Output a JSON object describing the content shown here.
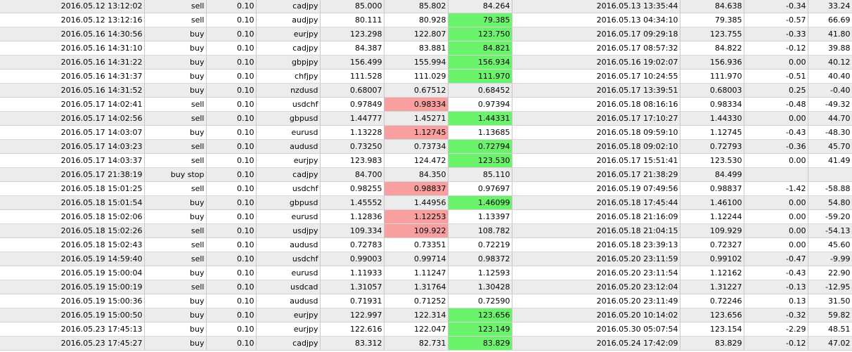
{
  "colors": {
    "profit_highlight": "#6cf36c",
    "loss_highlight": "#f8a0a0",
    "row_alt": "#ececec"
  },
  "rows": [
    {
      "open_time": "2016.05.12 13:12:02",
      "type": "sell",
      "size": "0.10",
      "symbol": "cadjpy",
      "price": "85.000",
      "sl": "85.802",
      "tp": "84.264",
      "close_time": "2016.05.13 13:35:44",
      "close_price": "84.638",
      "swap": "-0.34",
      "profit": "33.24",
      "sl_hl": "",
      "tp_hl": ""
    },
    {
      "open_time": "2016.05.12 13:12:16",
      "type": "sell",
      "size": "0.10",
      "symbol": "audjpy",
      "price": "80.111",
      "sl": "80.928",
      "tp": "79.385",
      "close_time": "2016.05.13 04:34:10",
      "close_price": "79.385",
      "swap": "-0.57",
      "profit": "66.69",
      "sl_hl": "",
      "tp_hl": "green"
    },
    {
      "open_time": "2016.05.16 14:30:56",
      "type": "buy",
      "size": "0.10",
      "symbol": "eurjpy",
      "price": "123.298",
      "sl": "122.807",
      "tp": "123.750",
      "close_time": "2016.05.17 09:29:18",
      "close_price": "123.755",
      "swap": "-0.33",
      "profit": "41.80",
      "sl_hl": "",
      "tp_hl": "green"
    },
    {
      "open_time": "2016.05.16 14:31:10",
      "type": "buy",
      "size": "0.10",
      "symbol": "cadjpy",
      "price": "84.387",
      "sl": "83.881",
      "tp": "84.821",
      "close_time": "2016.05.17 08:57:32",
      "close_price": "84.822",
      "swap": "-0.12",
      "profit": "39.88",
      "sl_hl": "",
      "tp_hl": "green"
    },
    {
      "open_time": "2016.05.16 14:31:22",
      "type": "buy",
      "size": "0.10",
      "symbol": "gbpjpy",
      "price": "156.499",
      "sl": "155.994",
      "tp": "156.934",
      "close_time": "2016.05.16 19:02:07",
      "close_price": "156.936",
      "swap": "0.00",
      "profit": "40.12",
      "sl_hl": "",
      "tp_hl": "green"
    },
    {
      "open_time": "2016.05.16 14:31:37",
      "type": "buy",
      "size": "0.10",
      "symbol": "chfjpy",
      "price": "111.528",
      "sl": "111.029",
      "tp": "111.970",
      "close_time": "2016.05.17 10:24:55",
      "close_price": "111.970",
      "swap": "-0.51",
      "profit": "40.40",
      "sl_hl": "",
      "tp_hl": "green"
    },
    {
      "open_time": "2016.05.16 14:31:52",
      "type": "buy",
      "size": "0.10",
      "symbol": "nzdusd",
      "price": "0.68007",
      "sl": "0.67512",
      "tp": "0.68452",
      "close_time": "2016.05.17 13:39:51",
      "close_price": "0.68003",
      "swap": "0.25",
      "profit": "-0.40",
      "sl_hl": "",
      "tp_hl": ""
    },
    {
      "open_time": "2016.05.17 14:02:41",
      "type": "sell",
      "size": "0.10",
      "symbol": "usdchf",
      "price": "0.97849",
      "sl": "0.98334",
      "tp": "0.97394",
      "close_time": "2016.05.18 08:16:16",
      "close_price": "0.98334",
      "swap": "-0.48",
      "profit": "-49.32",
      "sl_hl": "red",
      "tp_hl": ""
    },
    {
      "open_time": "2016.05.17 14:02:56",
      "type": "sell",
      "size": "0.10",
      "symbol": "gbpusd",
      "price": "1.44777",
      "sl": "1.45271",
      "tp": "1.44331",
      "close_time": "2016.05.17 17:10:27",
      "close_price": "1.44330",
      "swap": "0.00",
      "profit": "44.70",
      "sl_hl": "",
      "tp_hl": "green"
    },
    {
      "open_time": "2016.05.17 14:03:07",
      "type": "buy",
      "size": "0.10",
      "symbol": "eurusd",
      "price": "1.13228",
      "sl": "1.12745",
      "tp": "1.13685",
      "close_time": "2016.05.18 09:59:10",
      "close_price": "1.12745",
      "swap": "-0.43",
      "profit": "-48.30",
      "sl_hl": "red",
      "tp_hl": ""
    },
    {
      "open_time": "2016.05.17 14:03:23",
      "type": "sell",
      "size": "0.10",
      "symbol": "audusd",
      "price": "0.73250",
      "sl": "0.73734",
      "tp": "0.72794",
      "close_time": "2016.05.18 09:02:10",
      "close_price": "0.72793",
      "swap": "-0.36",
      "profit": "45.70",
      "sl_hl": "",
      "tp_hl": "green"
    },
    {
      "open_time": "2016.05.17 14:03:37",
      "type": "sell",
      "size": "0.10",
      "symbol": "eurjpy",
      "price": "123.983",
      "sl": "124.472",
      "tp": "123.530",
      "close_time": "2016.05.17 15:51:41",
      "close_price": "123.530",
      "swap": "0.00",
      "profit": "41.49",
      "sl_hl": "",
      "tp_hl": "green"
    },
    {
      "open_time": "2016.05.17 21:38:19",
      "type": "buy stop",
      "size": "0.10",
      "symbol": "cadjpy",
      "price": "84.700",
      "sl": "84.350",
      "tp": "85.110",
      "close_time": "2016.05.17 21:38:29",
      "close_price": "84.499",
      "swap": "",
      "profit": "",
      "sl_hl": "",
      "tp_hl": ""
    },
    {
      "open_time": "2016.05.18 15:01:25",
      "type": "sell",
      "size": "0.10",
      "symbol": "usdchf",
      "price": "0.98255",
      "sl": "0.98837",
      "tp": "0.97697",
      "close_time": "2016.05.19 07:49:56",
      "close_price": "0.98837",
      "swap": "-1.42",
      "profit": "-58.88",
      "sl_hl": "red",
      "tp_hl": ""
    },
    {
      "open_time": "2016.05.18 15:01:54",
      "type": "buy",
      "size": "0.10",
      "symbol": "gbpusd",
      "price": "1.45552",
      "sl": "1.44956",
      "tp": "1.46099",
      "close_time": "2016.05.18 17:45:44",
      "close_price": "1.46100",
      "swap": "0.00",
      "profit": "54.80",
      "sl_hl": "",
      "tp_hl": "green"
    },
    {
      "open_time": "2016.05.18 15:02:06",
      "type": "buy",
      "size": "0.10",
      "symbol": "eurusd",
      "price": "1.12836",
      "sl": "1.12253",
      "tp": "1.13397",
      "close_time": "2016.05.18 21:16:09",
      "close_price": "1.12244",
      "swap": "0.00",
      "profit": "-59.20",
      "sl_hl": "red",
      "tp_hl": ""
    },
    {
      "open_time": "2016.05.18 15:02:26",
      "type": "sell",
      "size": "0.10",
      "symbol": "usdjpy",
      "price": "109.334",
      "sl": "109.922",
      "tp": "108.782",
      "close_time": "2016.05.18 21:04:15",
      "close_price": "109.929",
      "swap": "0.00",
      "profit": "-54.13",
      "sl_hl": "red",
      "tp_hl": ""
    },
    {
      "open_time": "2016.05.18 15:02:43",
      "type": "sell",
      "size": "0.10",
      "symbol": "audusd",
      "price": "0.72783",
      "sl": "0.73351",
      "tp": "0.72219",
      "close_time": "2016.05.18 23:39:13",
      "close_price": "0.72327",
      "swap": "0.00",
      "profit": "45.60",
      "sl_hl": "",
      "tp_hl": ""
    },
    {
      "open_time": "2016.05.19 14:59:40",
      "type": "sell",
      "size": "0.10",
      "symbol": "usdchf",
      "price": "0.99003",
      "sl": "0.99714",
      "tp": "0.98372",
      "close_time": "2016.05.20 23:11:59",
      "close_price": "0.99102",
      "swap": "-0.47",
      "profit": "-9.99",
      "sl_hl": "",
      "tp_hl": ""
    },
    {
      "open_time": "2016.05.19 15:00:04",
      "type": "buy",
      "size": "0.10",
      "symbol": "eurusd",
      "price": "1.11933",
      "sl": "1.11247",
      "tp": "1.12593",
      "close_time": "2016.05.20 23:11:54",
      "close_price": "1.12162",
      "swap": "-0.43",
      "profit": "22.90",
      "sl_hl": "",
      "tp_hl": ""
    },
    {
      "open_time": "2016.05.19 15:00:19",
      "type": "sell",
      "size": "0.10",
      "symbol": "usdcad",
      "price": "1.31057",
      "sl": "1.31764",
      "tp": "1.30428",
      "close_time": "2016.05.20 23:12:04",
      "close_price": "1.31227",
      "swap": "-0.13",
      "profit": "-12.95",
      "sl_hl": "",
      "tp_hl": ""
    },
    {
      "open_time": "2016.05.19 15:00:36",
      "type": "buy",
      "size": "0.10",
      "symbol": "audusd",
      "price": "0.71931",
      "sl": "0.71252",
      "tp": "0.72590",
      "close_time": "2016.05.20 23:11:49",
      "close_price": "0.72246",
      "swap": "0.13",
      "profit": "31.50",
      "sl_hl": "",
      "tp_hl": ""
    },
    {
      "open_time": "2016.05.19 15:00:50",
      "type": "buy",
      "size": "0.10",
      "symbol": "eurjpy",
      "price": "122.997",
      "sl": "122.314",
      "tp": "123.656",
      "close_time": "2016.05.20 10:14:02",
      "close_price": "123.656",
      "swap": "-0.32",
      "profit": "59.82",
      "sl_hl": "",
      "tp_hl": "green"
    },
    {
      "open_time": "2016.05.23 17:45:13",
      "type": "buy",
      "size": "0.10",
      "symbol": "eurjpy",
      "price": "122.616",
      "sl": "122.047",
      "tp": "123.149",
      "close_time": "2016.05.30 05:07:54",
      "close_price": "123.154",
      "swap": "-2.29",
      "profit": "48.51",
      "sl_hl": "",
      "tp_hl": "green"
    },
    {
      "open_time": "2016.05.23 17:45:27",
      "type": "buy",
      "size": "0.10",
      "symbol": "cadjpy",
      "price": "83.312",
      "sl": "82.731",
      "tp": "83.829",
      "close_time": "2016.05.24 17:42:09",
      "close_price": "83.829",
      "swap": "-0.12",
      "profit": "47.02",
      "sl_hl": "",
      "tp_hl": "green"
    }
  ]
}
